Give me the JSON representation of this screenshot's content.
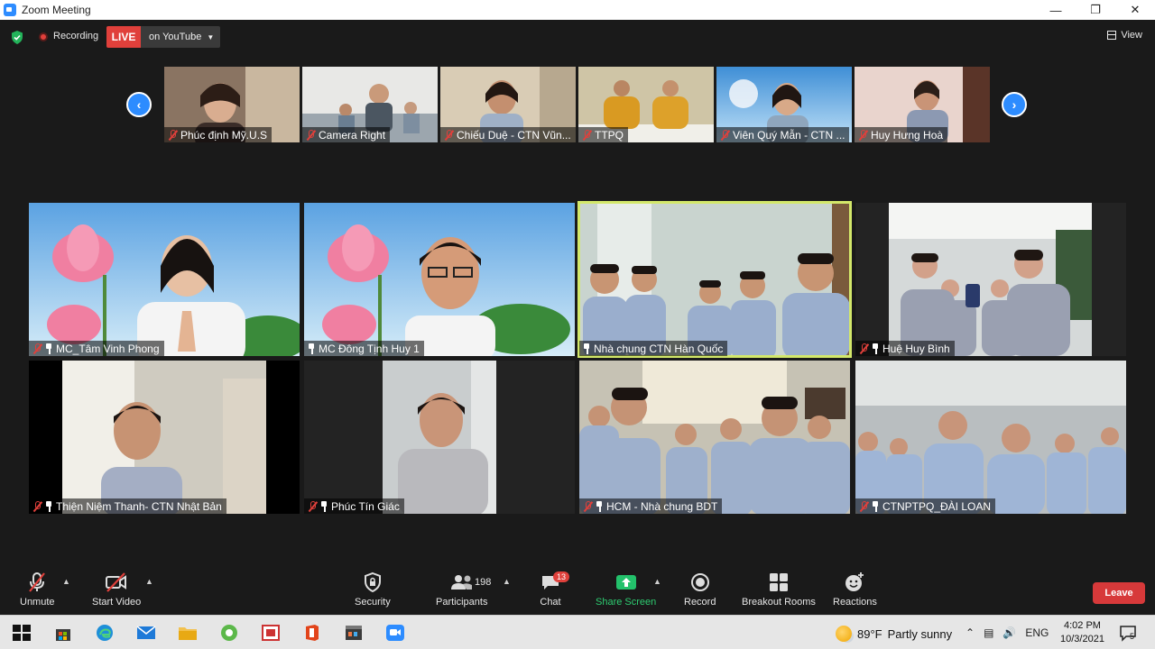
{
  "window": {
    "title": "Zoom Meeting"
  },
  "topbar": {
    "recording_label": "Recording",
    "live_label": "LIVE",
    "stream_label": "on YouTube",
    "view_label": "View"
  },
  "filmstrip": [
    {
      "name": "Phúc định Mỹ.U.S",
      "muted": true
    },
    {
      "name": "Camera Right",
      "muted": true
    },
    {
      "name": "Chiếu Duệ - CTN Vũn...",
      "muted": true
    },
    {
      "name": "TTPQ",
      "muted": true
    },
    {
      "name": "Viên Quý Mẫn - CTN ...",
      "muted": true
    },
    {
      "name": "Huy Hưng Hoà",
      "muted": true
    }
  ],
  "gallery": [
    {
      "name": "MC_Tâm Vinh Phong",
      "muted": true,
      "pinned": true
    },
    {
      "name": "MC Đông Tịnh Huy 1",
      "muted": false,
      "pinned": true
    },
    {
      "name": "Nhà chung CTN Hàn Quốc",
      "muted": false,
      "pinned": true,
      "active_speaker": true
    },
    {
      "name": "Huệ Huy Bình",
      "muted": true,
      "pinned": true
    },
    {
      "name": "Thiện Niệm Thanh- CTN Nhật Bản",
      "muted": true,
      "pinned": true
    },
    {
      "name": "Phúc Tín Giác",
      "muted": true,
      "pinned": true
    },
    {
      "name": "HCM - Nhà chung BDT",
      "muted": true,
      "pinned": true
    },
    {
      "name": "CTNPTPQ_ĐÀI LOAN",
      "muted": true,
      "pinned": true
    }
  ],
  "toolbar": {
    "unmute_label": "Unmute",
    "start_video_label": "Start Video",
    "security_label": "Security",
    "participants_label": "Participants",
    "participants_count": "198",
    "chat_label": "Chat",
    "chat_badge": "13",
    "share_label": "Share Screen",
    "record_label": "Record",
    "breakout_label": "Breakout Rooms",
    "reactions_label": "Reactions",
    "leave_label": "Leave"
  },
  "taskbar": {
    "temperature": "89°F",
    "weather": "Partly sunny",
    "language": "ENG",
    "time": "4:02 PM",
    "date": "10/3/2021",
    "notification_count": "5"
  },
  "colors": {
    "accent": "#2d8cff",
    "live": "#e0403b",
    "active_speaker": "#d3e86a",
    "share_green": "#2ecc71",
    "leave": "#d7393a"
  }
}
